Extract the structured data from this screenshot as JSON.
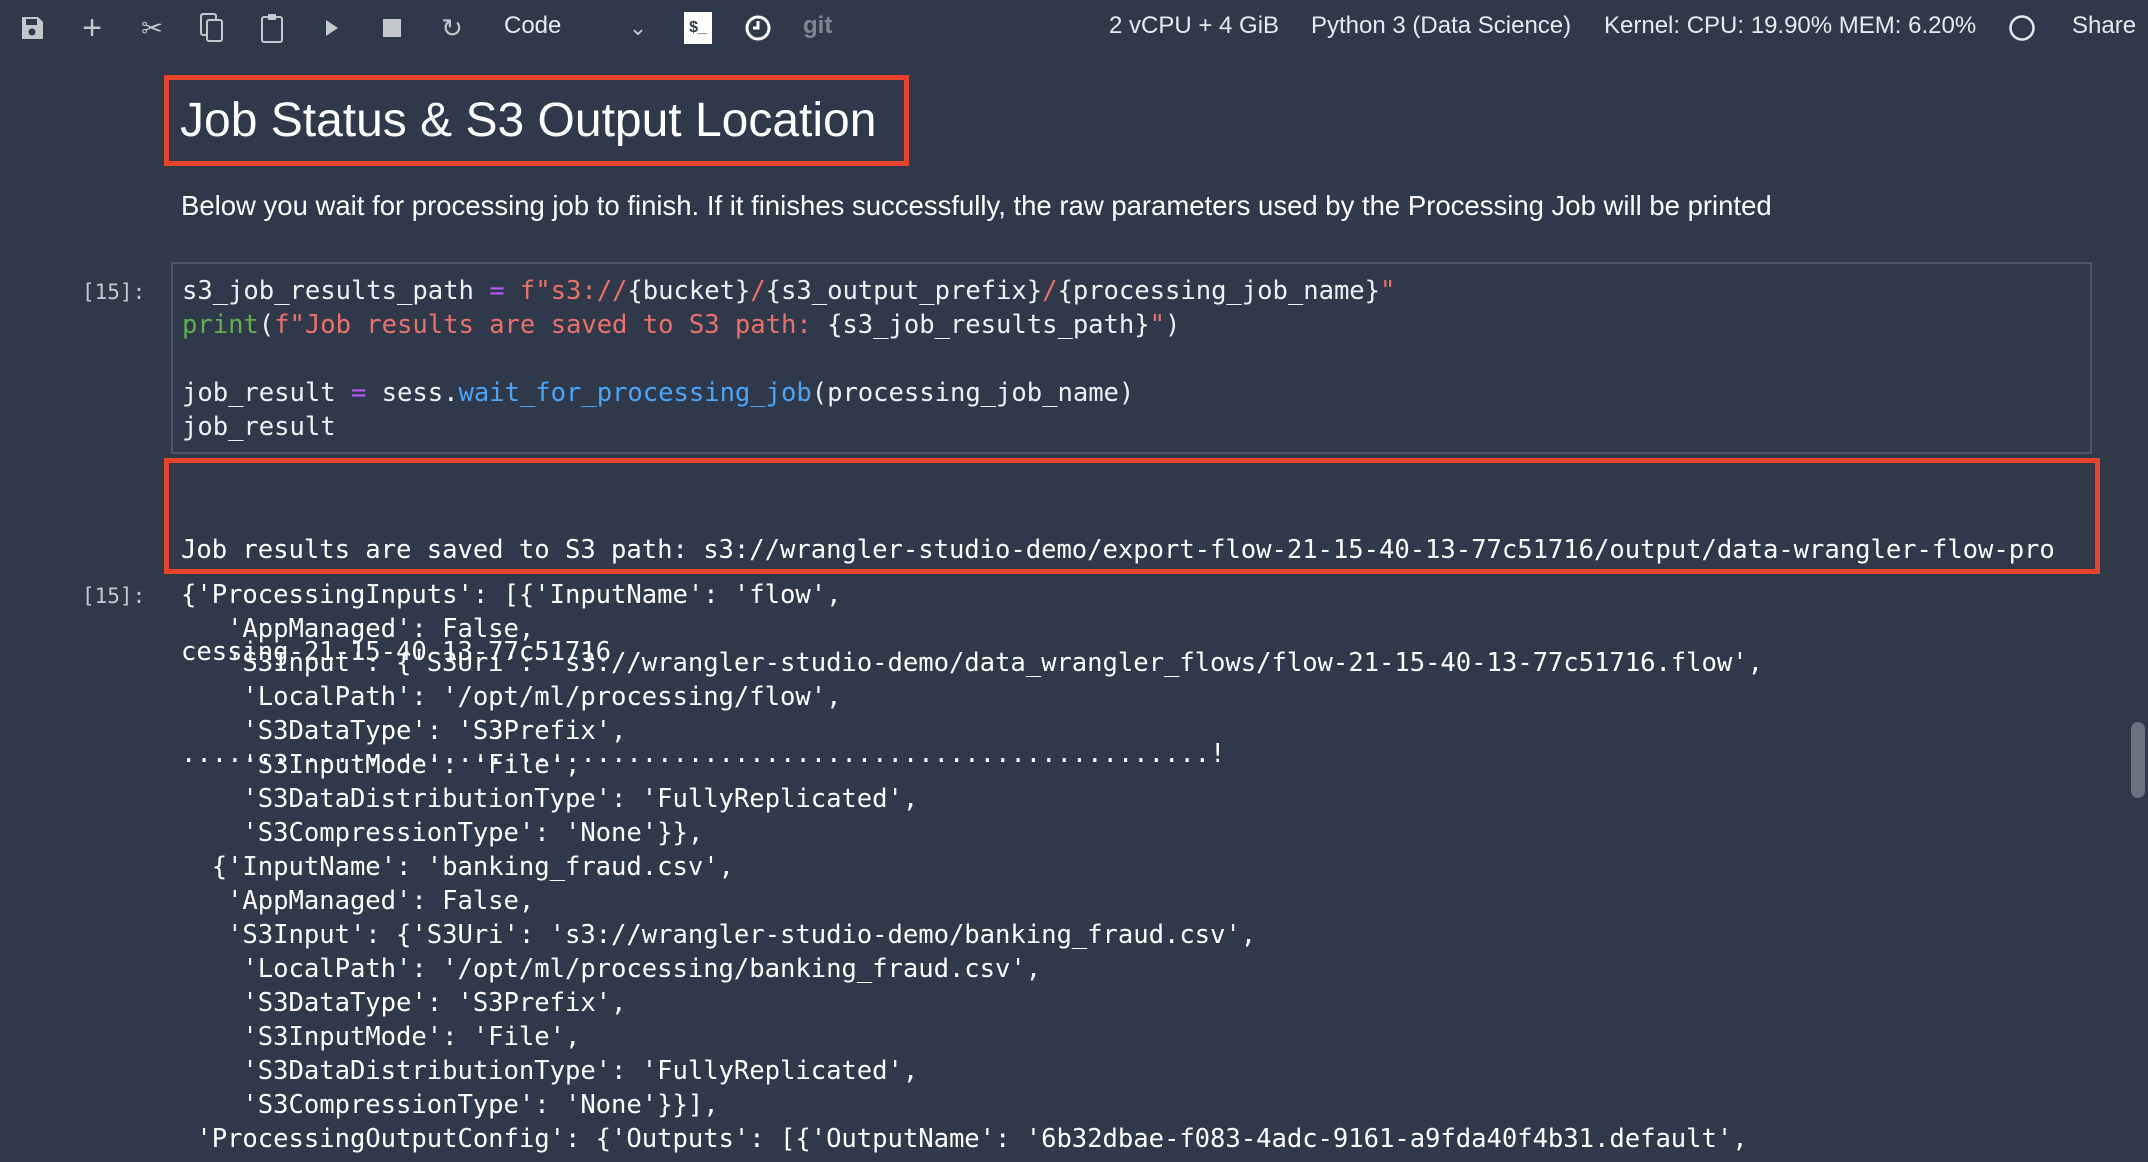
{
  "toolbar": {
    "icons": [
      "save-icon",
      "add-cell-icon",
      "cut-icon",
      "copy-icon",
      "paste-icon",
      "run-icon",
      "stop-icon",
      "restart-icon"
    ],
    "cell_type": "Code",
    "terminal_label": "$_",
    "git_label": "git",
    "instance": "2 vCPU + 4 GiB",
    "kernel_name": "Python 3 (Data Science)",
    "kernel_usage": "Kernel: CPU: 19.90% MEM: 6.20%",
    "share_label": "Share"
  },
  "markdown": {
    "title": "Job Status & S3 Output Location",
    "paragraph": "Below you wait for processing job to finish. If it finishes successfully, the raw parameters used by the Processing Job will be printed"
  },
  "cell": {
    "input_prompt": "[15]:",
    "output_prompt": "[15]:",
    "code_lines": [
      [
        [
          "",
          "s3_job_results_path "
        ],
        [
          "op",
          "="
        ],
        [
          "str",
          " f\"s3://"
        ],
        [
          "",
          "{bucket}"
        ],
        [
          "str",
          "/"
        ],
        [
          "",
          "{s3_output_prefix}"
        ],
        [
          "str",
          "/"
        ],
        [
          "",
          "{processing_job_name}"
        ],
        [
          "str",
          "\""
        ]
      ],
      [
        [
          "kw",
          "print"
        ],
        [
          "",
          "("
        ],
        [
          "str",
          "f\"Job results are saved to S3 path: "
        ],
        [
          "",
          "{s3_job_results_path}"
        ],
        [
          "str",
          "\""
        ],
        [
          "",
          ")"
        ]
      ],
      [],
      [
        [
          "",
          "job_result "
        ],
        [
          "op",
          "="
        ],
        [
          "",
          " sess."
        ],
        [
          "fn",
          "wait_for_processing_job"
        ],
        [
          "",
          "(processing_job_name)"
        ]
      ],
      [
        [
          "",
          "job_result"
        ]
      ]
    ],
    "stdout_lines": [
      "Job results are saved to S3 path: s3://wrangler-studio-demo/export-flow-21-15-40-13-77c51716/output/data-wrangler-flow-pro",
      "cessing-21-15-40-13-77c51716",
      "...................................................................!"
    ],
    "result_lines": [
      "{'ProcessingInputs': [{'InputName': 'flow',",
      "   'AppManaged': False,",
      "   'S3Input': {'S3Uri': 's3://wrangler-studio-demo/data_wrangler_flows/flow-21-15-40-13-77c51716.flow',",
      "    'LocalPath': '/opt/ml/processing/flow',",
      "    'S3DataType': 'S3Prefix',",
      "    'S3InputMode': 'File',",
      "    'S3DataDistributionType': 'FullyReplicated',",
      "    'S3CompressionType': 'None'}},",
      "  {'InputName': 'banking_fraud.csv',",
      "   'AppManaged': False,",
      "   'S3Input': {'S3Uri': 's3://wrangler-studio-demo/banking_fraud.csv',",
      "    'LocalPath': '/opt/ml/processing/banking_fraud.csv',",
      "    'S3DataType': 'S3Prefix',",
      "    'S3InputMode': 'File',",
      "    'S3DataDistributionType': 'FullyReplicated',",
      "    'S3CompressionType': 'None'}}],",
      " 'ProcessingOutputConfig': {'Outputs': [{'OutputName': '6b32dbae-f083-4adc-9161-a9fda40f4b31.default',"
    ]
  }
}
